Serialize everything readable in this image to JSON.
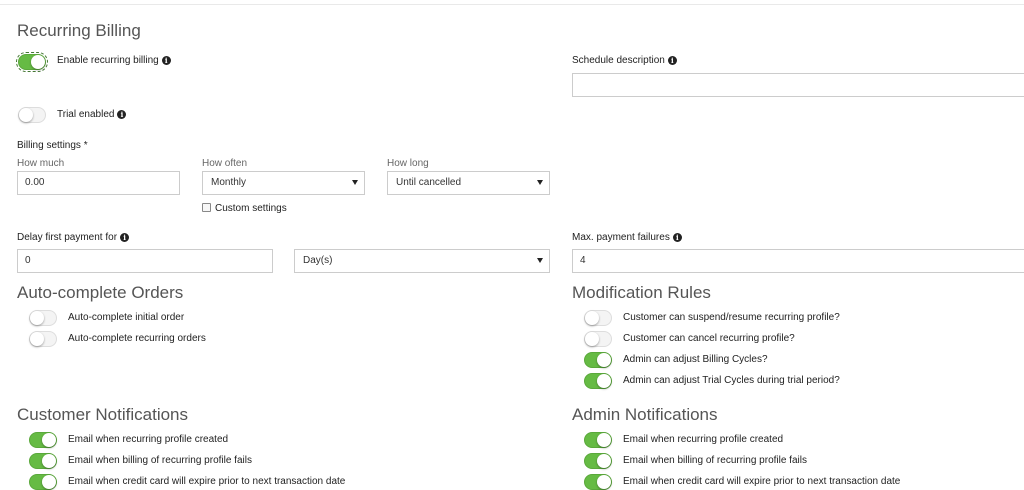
{
  "colors": {
    "toggle_on": "#66bb44",
    "toggle_off": "#f4f4f4",
    "border": "#cccccc"
  },
  "recurring_billing": {
    "title": "Recurring Billing",
    "enable_label": "Enable recurring billing",
    "enable_on": true,
    "trial_label": "Trial enabled",
    "trial_on": false,
    "schedule_description_label": "Schedule description",
    "schedule_description_value": ""
  },
  "billing_settings": {
    "label": "Billing settings *",
    "how_much_label": "How much",
    "how_much_value": "0.00",
    "how_often_label": "How often",
    "how_often_value": "Monthly",
    "how_long_label": "How long",
    "how_long_value": "Until cancelled",
    "custom_settings_label": "Custom settings",
    "custom_settings_checked": false
  },
  "delay": {
    "label": "Delay first payment for",
    "value": "0",
    "unit_value": "Day(s)"
  },
  "max_failures": {
    "label": "Max. payment failures",
    "value": "4"
  },
  "auto_complete": {
    "title": "Auto-complete Orders",
    "items": [
      {
        "label": "Auto-complete initial order",
        "on": false
      },
      {
        "label": "Auto-complete recurring orders",
        "on": false
      }
    ]
  },
  "modification_rules": {
    "title": "Modification Rules",
    "items": [
      {
        "label": "Customer can suspend/resume recurring profile?",
        "on": false
      },
      {
        "label": "Customer can cancel recurring profile?",
        "on": false
      },
      {
        "label": "Admin can adjust Billing Cycles?",
        "on": true
      },
      {
        "label": "Admin can adjust Trial Cycles during trial period?",
        "on": true
      }
    ]
  },
  "customer_notifications": {
    "title": "Customer Notifications",
    "items": [
      {
        "label": "Email when recurring profile created",
        "on": true
      },
      {
        "label": "Email when billing of recurring profile fails",
        "on": true
      },
      {
        "label": "Email when credit card will expire prior to next transaction date",
        "on": true
      }
    ]
  },
  "admin_notifications": {
    "title": "Admin Notifications",
    "items": [
      {
        "label": "Email when recurring profile created",
        "on": true
      },
      {
        "label": "Email when billing of recurring profile fails",
        "on": true
      },
      {
        "label": "Email when credit card will expire prior to next transaction date",
        "on": true
      }
    ]
  }
}
